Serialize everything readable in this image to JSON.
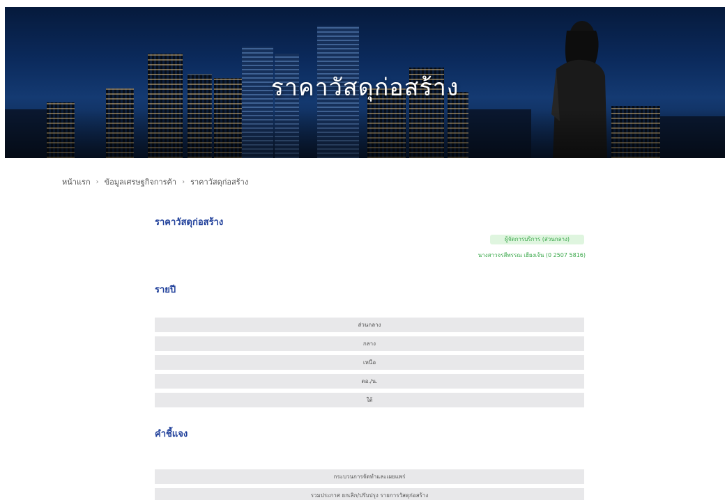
{
  "hero": {
    "title": "ราคาวัสดุก่อสร้าง"
  },
  "breadcrumb": [
    {
      "label": "หน้าแรก"
    },
    {
      "label": "ข้อมูลเศรษฐกิจการค้า"
    },
    {
      "label": "ราคาวัสดุก่อสร้าง"
    }
  ],
  "breadcrumb_separator": "›",
  "page": {
    "title": "ราคาวัสดุก่อสร้าง",
    "badge": "ผู้จัดการบริการ (ส่วนกลาง)",
    "contact": "นางสาวจรสีพรรณ เฮียงเจ้น (0 2507 5816)"
  },
  "annual": {
    "title": "รายปี",
    "items": [
      "ส่วนกลาง",
      "กลาง",
      "เหนือ",
      "ตอ./น.",
      "ใต้"
    ]
  },
  "notes": {
    "title": "คำชี้แจง",
    "items": [
      "กระบวนการจัดทำและเผยแพร่",
      "รวมประกาศ ยกเลิก/ปรับปรุง รายการวัสดุก่อสร้าง"
    ]
  }
}
